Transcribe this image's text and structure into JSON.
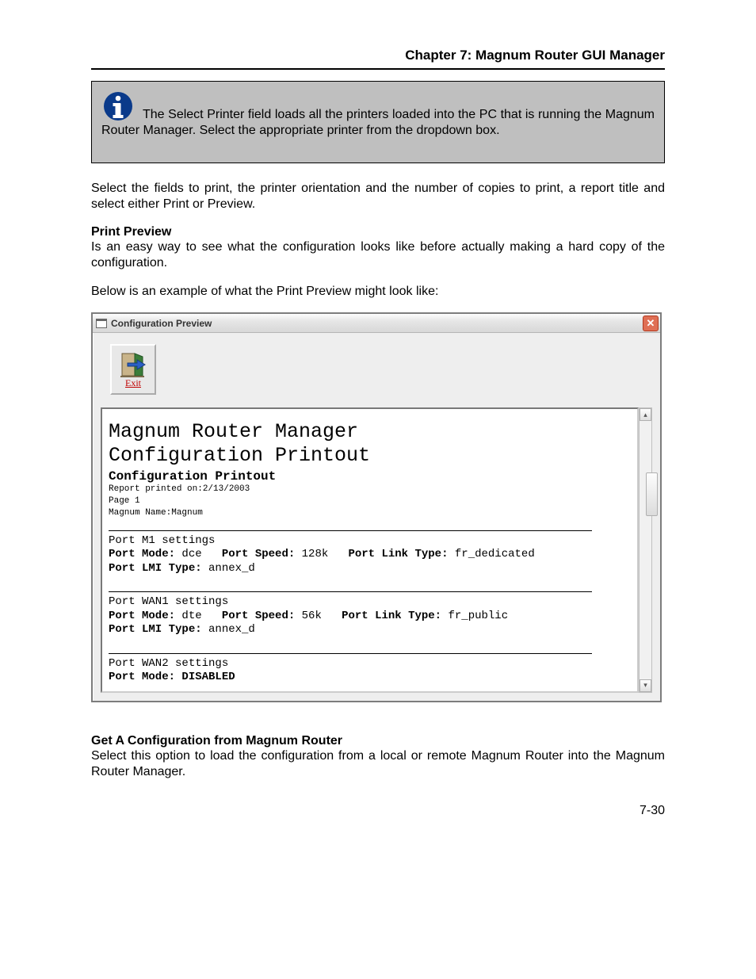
{
  "header": {
    "chapter_title": "Chapter 7: Magnum Router GUI Manager"
  },
  "info_box": {
    "text": "The Select Printer field loads all the printers loaded into the PC that is running the Magnum Router Manager.  Select the appropriate printer from the dropdown box."
  },
  "body": {
    "para1": "Select the fields to print, the printer orientation and the number of copies to print, a report title and select either Print or Preview.",
    "print_preview_heading": "Print Preview",
    "print_preview_para": "Is an easy way to see what the configuration looks like before actually making a hard copy of the configuration.",
    "example_intro": "Below is an example of what the Print Preview might look like:",
    "get_config_heading": "Get A Configuration from Magnum Router",
    "get_config_para": "Select this option to load the configuration from a local or remote Magnum Router into the Magnum Router Manager."
  },
  "window": {
    "title": "Configuration Preview",
    "exit_label": "Exit",
    "close_glyph": "✕",
    "scroll_up": "▴",
    "scroll_down": "▾"
  },
  "preview": {
    "big_title_1": "Magnum Router Manager",
    "big_title_2": "Configuration Printout",
    "sub_title": "Configuration Printout",
    "report_date_line": "Report printed on:2/13/2003",
    "page_line": "Page 1",
    "name_line": "Magnum Name:Magnum",
    "sections": [
      {
        "heading": "Port M1 settings",
        "line1": {
          "k1": "Port Mode:",
          "v1": " dce   ",
          "k2": "Port Speed:",
          "v2": " 128k   ",
          "k3": "Port Link Type:",
          "v3": " fr_dedicated"
        },
        "line2": {
          "k1": "Port LMI Type:",
          "v1": " annex_d"
        }
      },
      {
        "heading": "Port WAN1 settings",
        "line1": {
          "k1": "Port Mode:",
          "v1": " dte   ",
          "k2": "Port Speed:",
          "v2": " 56k   ",
          "k3": "Port Link Type:",
          "v3": " fr_public"
        },
        "line2": {
          "k1": "Port LMI Type:",
          "v1": " annex_d"
        }
      },
      {
        "heading": "Port WAN2 settings",
        "line1": {
          "k1": "Port Mode: DISABLED",
          "v1": ""
        }
      }
    ]
  },
  "footer": {
    "page_num": "7-30"
  }
}
